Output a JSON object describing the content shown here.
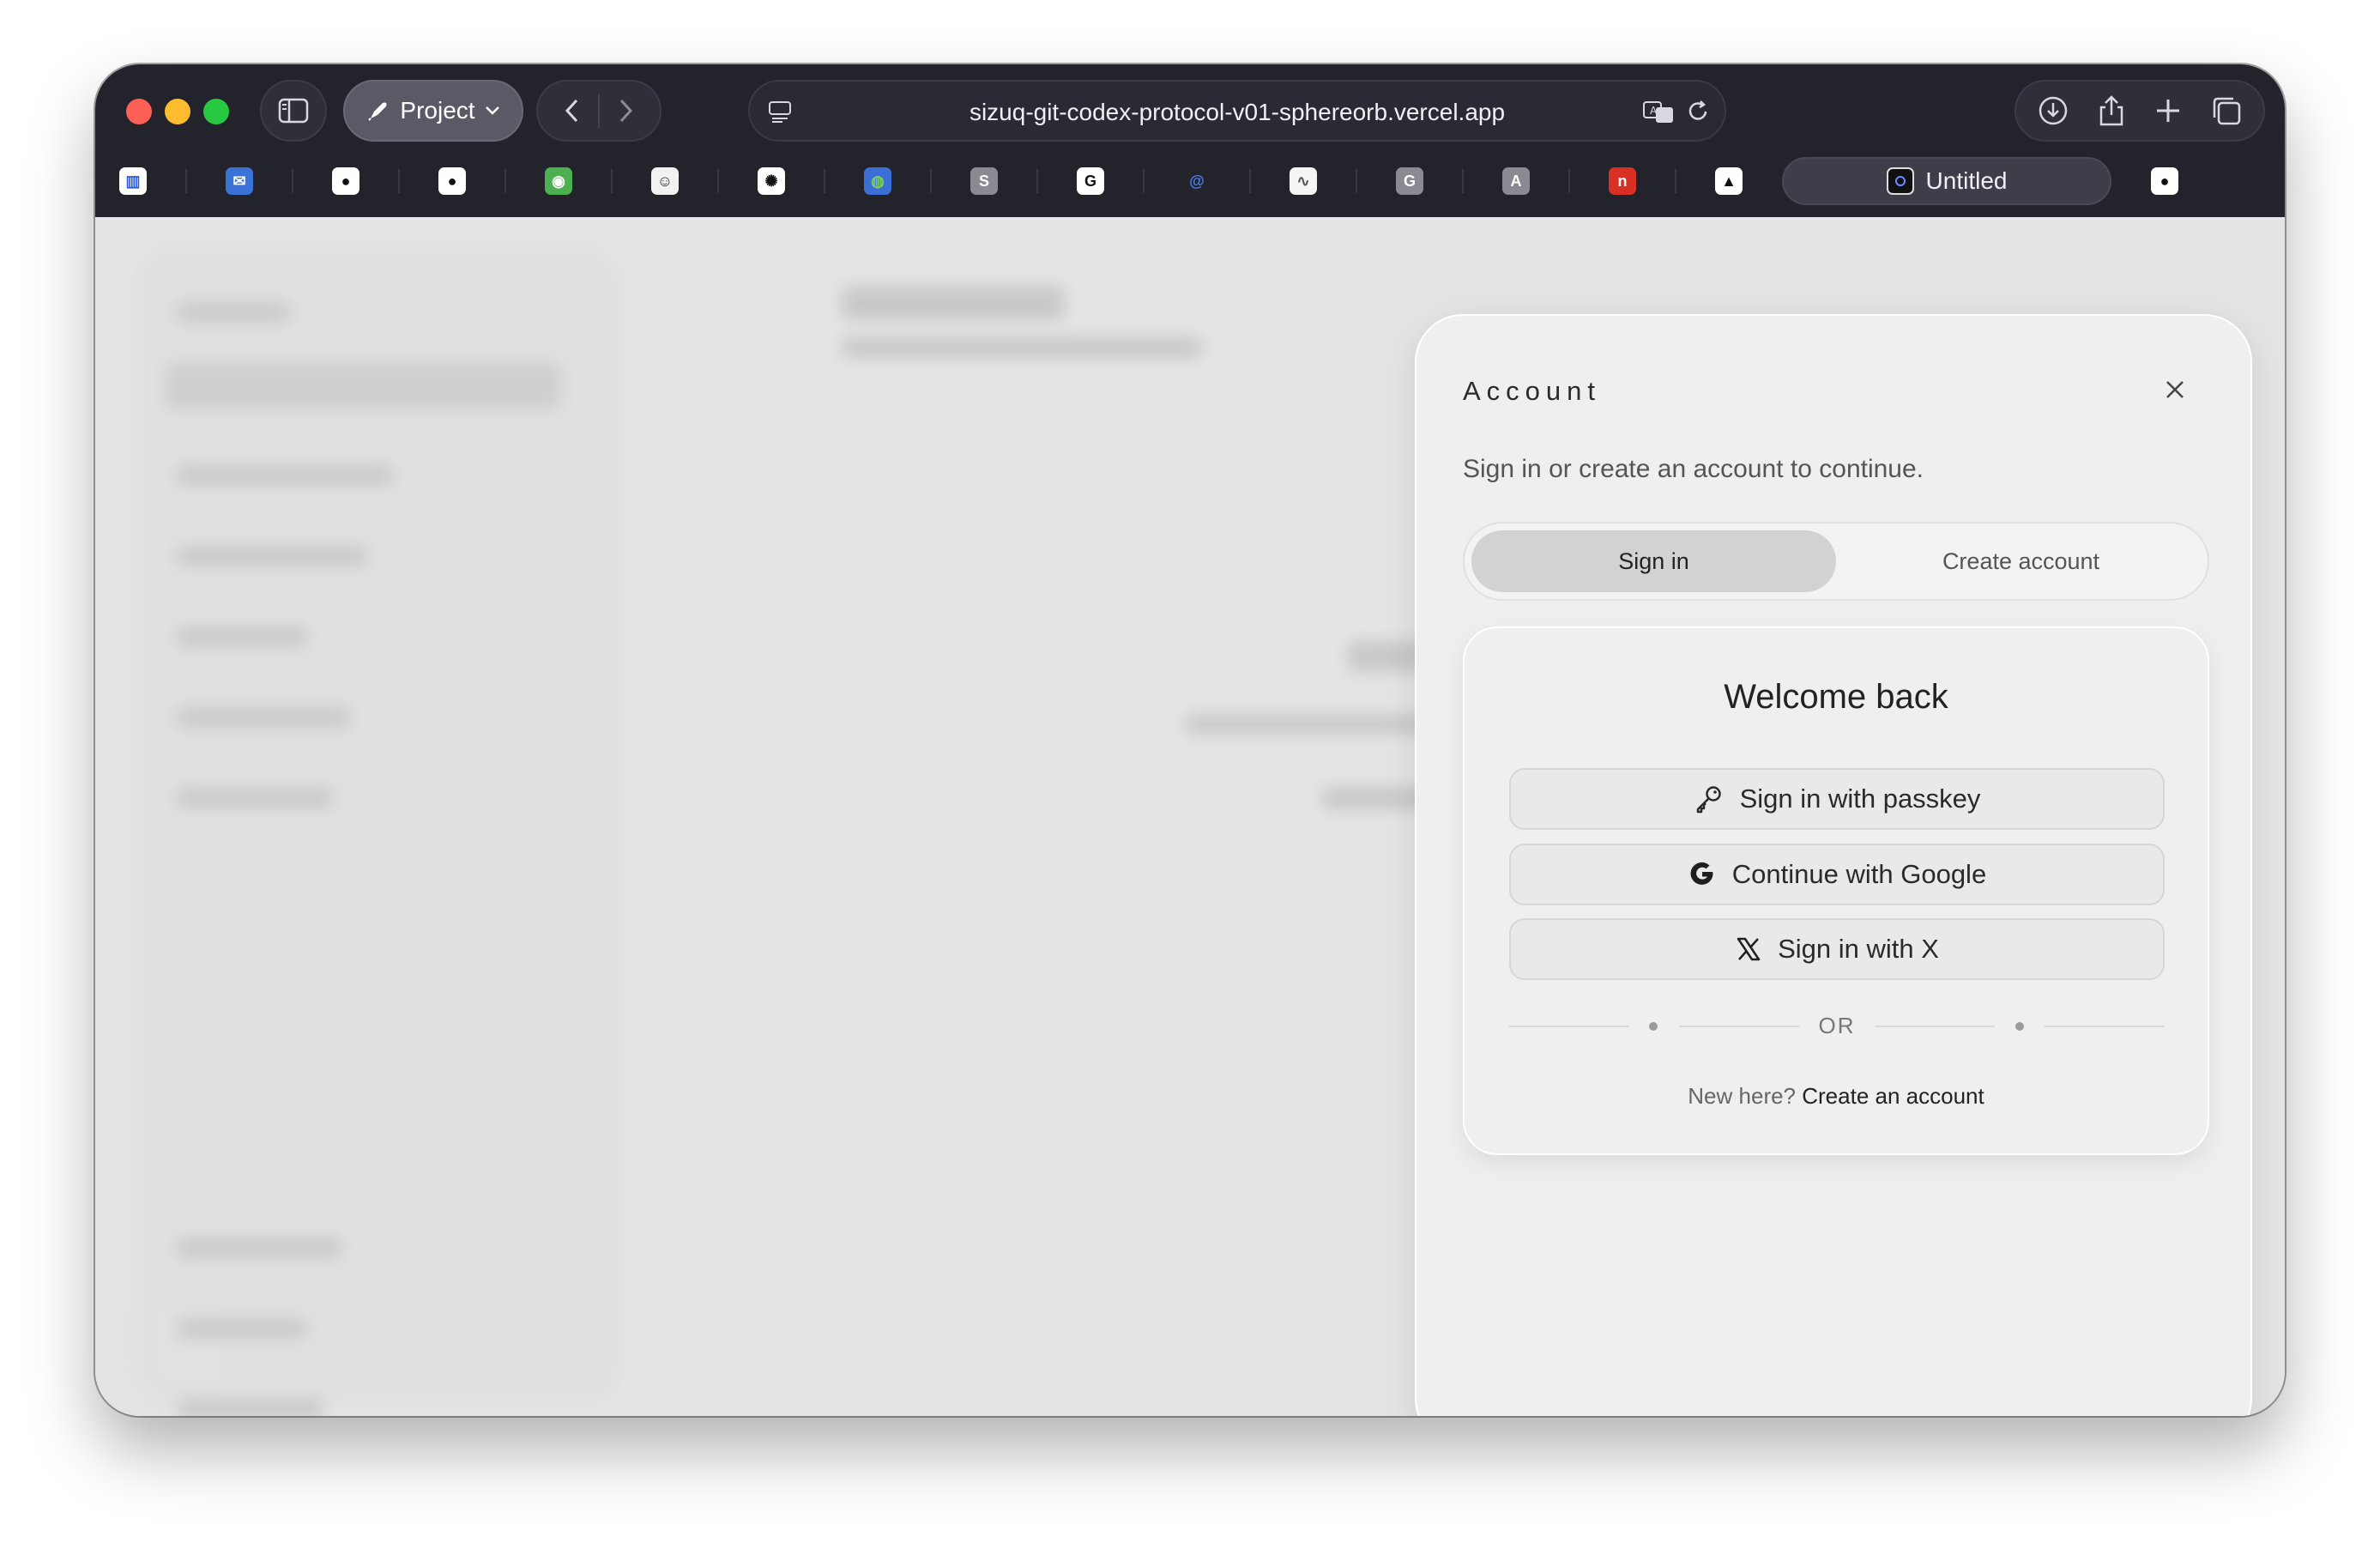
{
  "browser": {
    "project_label": "Project",
    "url": "sizuq-git-codex-protocol-v01-sphereorb.vercel.app",
    "active_tab_label": "Untitled",
    "bookmarks": [
      {
        "icon": "tasks-app-icon",
        "bg": "#ffffff",
        "fg": "#2a5bd7",
        "glyph": "▥"
      },
      {
        "icon": "mail-icon",
        "bg": "#3b72d6",
        "fg": "#ffffff",
        "glyph": "✉"
      },
      {
        "icon": "github-icon",
        "bg": "#ffffff",
        "fg": "#111111",
        "glyph": "●"
      },
      {
        "icon": "github-icon",
        "bg": "#ffffff",
        "fg": "#111111",
        "glyph": "●"
      },
      {
        "icon": "green-ring-icon",
        "bg": "#4caf50",
        "fg": "#ffffff",
        "glyph": "◉"
      },
      {
        "icon": "cat-face-icon",
        "bg": "#f2f2f2",
        "fg": "#333333",
        "glyph": "☺"
      },
      {
        "icon": "openai-icon",
        "bg": "#ffffff",
        "fg": "#111111",
        "glyph": "✺"
      },
      {
        "icon": "globe-icon",
        "bg": "#3b6fd6",
        "fg": "#7ccf5a",
        "glyph": "◍"
      },
      {
        "icon": "s-letter-icon",
        "bg": "#8a8a92",
        "fg": "#ffffff",
        "glyph": "S"
      },
      {
        "icon": "g-box-icon",
        "bg": "#ffffff",
        "fg": "#111111",
        "glyph": "G"
      },
      {
        "icon": "at-sign-icon",
        "bg": "#23232c",
        "fg": "#4a7ff0",
        "glyph": "@"
      },
      {
        "icon": "wave-icon",
        "bg": "#f5f5f5",
        "fg": "#555555",
        "glyph": "∿"
      },
      {
        "icon": "g-gray-icon",
        "bg": "#8a8a92",
        "fg": "#ffffff",
        "glyph": "G"
      },
      {
        "icon": "a-letter-icon",
        "bg": "#8a8a92",
        "fg": "#ffffff",
        "glyph": "A"
      },
      {
        "icon": "red-n-icon",
        "bg": "#d93025",
        "fg": "#ffffff",
        "glyph": "n"
      },
      {
        "icon": "triangle-icon",
        "bg": "#ffffff",
        "fg": "#111111",
        "glyph": "▲"
      }
    ]
  },
  "account": {
    "title": "Account",
    "subtitle": "Sign in or create an account to continue.",
    "tab_signin": "Sign in",
    "tab_create": "Create account",
    "welcome": "Welcome back",
    "btn_passkey": "Sign in with passkey",
    "btn_google": "Continue with Google",
    "btn_x": "Sign in with X",
    "or": "OR",
    "new_here": "New here?",
    "create_link": "Create an account"
  }
}
